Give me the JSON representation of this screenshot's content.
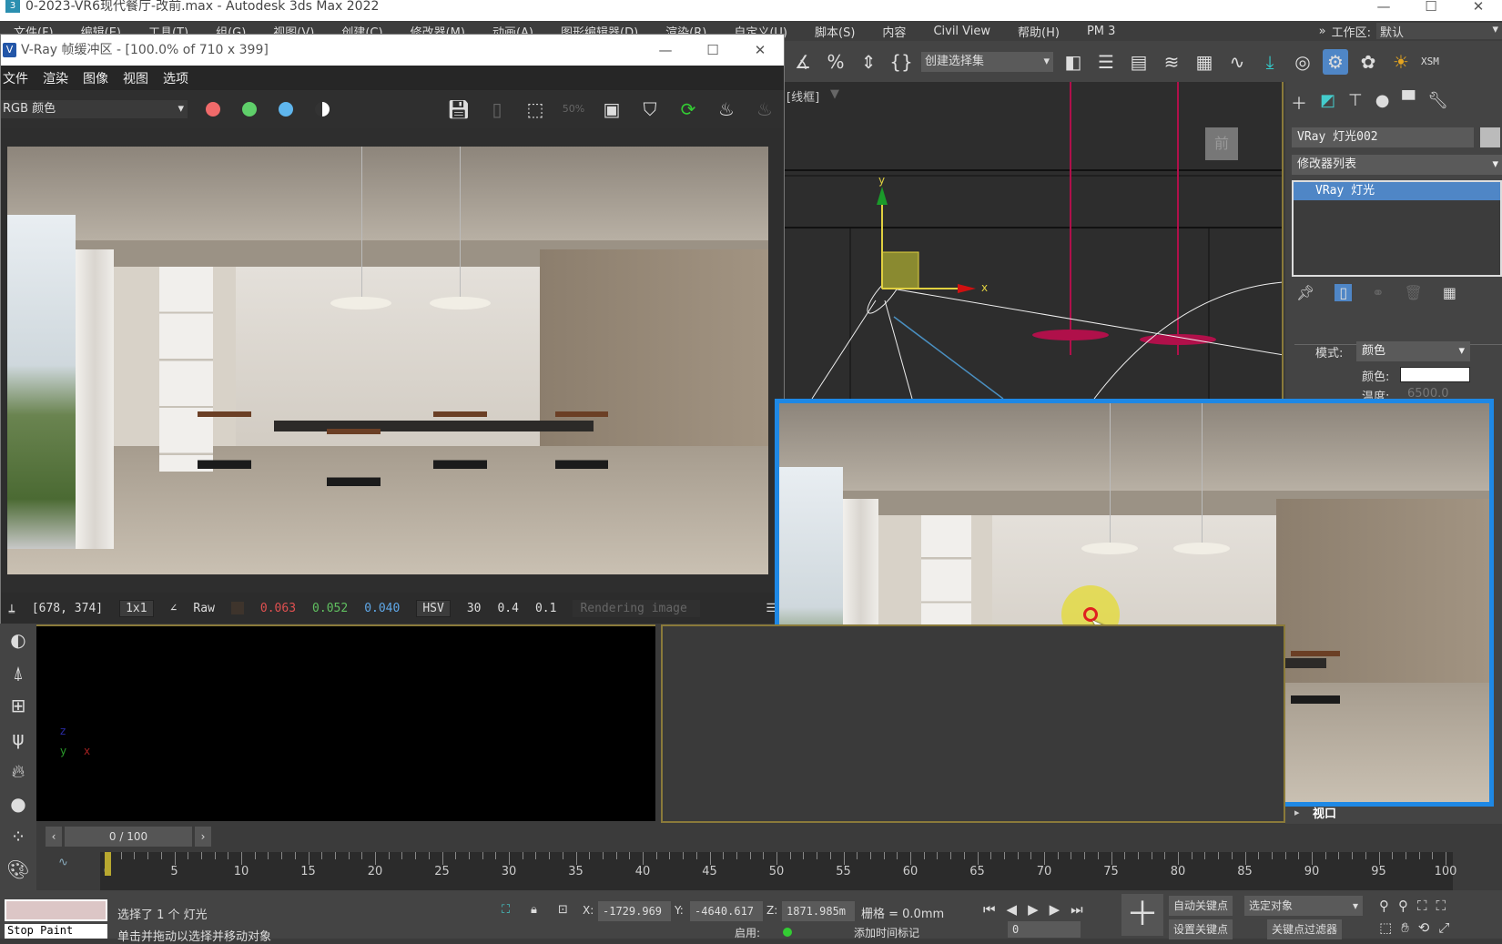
{
  "app": {
    "title": "0-2023-VR6现代餐厅-改前.max - Autodesk 3ds Max 2022",
    "win_controls": [
      "—",
      "☐",
      "✕"
    ]
  },
  "menu": [
    "文件(F)",
    "编辑(E)",
    "工具(T)",
    "组(G)",
    "视图(V)",
    "创建(C)",
    "修改器(M)",
    "动画(A)",
    "图形编辑器(D)",
    "渲染(R)",
    "自定义(U)",
    "脚本(S)",
    "内容",
    "Civil View",
    "帮助(H)",
    "PM 3"
  ],
  "workspace": {
    "overflow": "»",
    "label": "工作区:",
    "value": "默认"
  },
  "toolbar": {
    "selection_set": "创建选择集",
    "right_label": "XSM"
  },
  "vfb": {
    "title": "V-Ray 帧缓冲区 - [100.0% of 710 x 399]",
    "menu": [
      "文件",
      "渲染",
      "图像",
      "视图",
      "选项"
    ],
    "channel": "RGB 颜色",
    "status": {
      "coords": "[678, 374]",
      "sampling": "1x1",
      "mode": "Raw",
      "r": "0.063",
      "g": "0.052",
      "b": "0.040",
      "colorspace": "HSV",
      "h": "30",
      "s": "0.4",
      "v": "0.1",
      "progress_text": "Rendering image"
    },
    "colors": {
      "red": "#f06a6a",
      "green": "#5fcf6a",
      "blue": "#5fb6ee"
    }
  },
  "viewport": {
    "label": "[线框]",
    "viewcube": "前",
    "axis_x": "x",
    "axis_y": "y"
  },
  "panel": {
    "object_name": "VRay 灯光002",
    "modifier_list": "修改器列表",
    "stack": [
      "VRay 灯光"
    ],
    "mode_label": "模式:",
    "mode_value": "颜色",
    "color_label": "颜色:",
    "temp_label": "温度:",
    "temp_value": "6500.0",
    "rollout": "视口"
  },
  "timeline": {
    "frame": "0 / 100",
    "ticks": [
      0,
      5,
      10,
      15,
      20,
      25,
      30,
      35,
      40,
      45,
      50,
      55,
      60,
      65,
      70,
      75,
      80,
      85,
      90,
      95,
      100
    ],
    "current": 0
  },
  "status": {
    "maxscript": "Stop Paint",
    "selection": "选择了 1 个 灯光",
    "prompt": "单击并拖动以选择并移动对象",
    "x": "-1729.969",
    "y": "-4640.617",
    "z": "1871.985m",
    "grid": "栅格 = 0.0mm",
    "enable": "启用:",
    "add_time_tag": "添加时间标记",
    "auto_key": "自动关键点",
    "set_key": "设置关键点",
    "key_target": "选定对象",
    "key_filters": "关键点过滤器",
    "frame_field": "0"
  },
  "accent": "#1e88e5"
}
